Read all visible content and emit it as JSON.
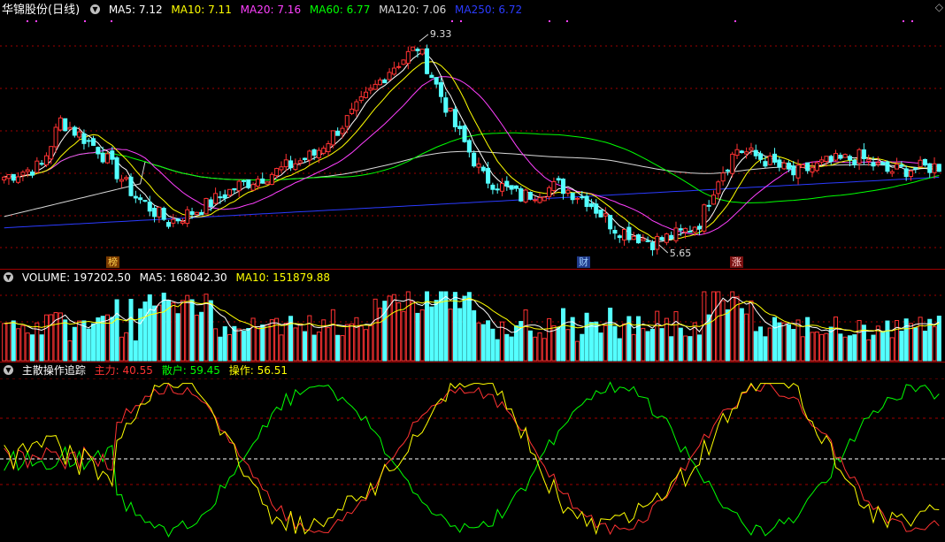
{
  "stock": {
    "title": "华锦股份(日线)"
  },
  "price_panel": {
    "ma": [
      {
        "label": "MA5: 7.12",
        "color": "#ffffff"
      },
      {
        "label": "MA10: 7.11",
        "color": "#ffff00"
      },
      {
        "label": "MA20: 7.16",
        "color": "#ff40ff"
      },
      {
        "label": "MA60: 6.77",
        "color": "#00ff00"
      },
      {
        "label": "MA120: 7.06",
        "color": "#d8d8d8"
      },
      {
        "label": "MA250: 6.72",
        "color": "#2b3bff"
      }
    ],
    "high_label": "9.33",
    "low_label": "5.65",
    "markers": [
      {
        "text": "榜",
        "bg": "#7a3a00",
        "color": "#ffd24d"
      },
      {
        "text": "财",
        "bg": "#1f3a8a",
        "color": "#9fd0ff"
      },
      {
        "text": "涨",
        "bg": "#7a1010",
        "color": "#ffd0d0"
      }
    ],
    "diamond_icon": "◇"
  },
  "volume_panel": {
    "label": "VOLUME: 197202.50",
    "ma5": "MA5: 168042.30",
    "ma10": "MA10: 151879.88"
  },
  "indicator_panel": {
    "name": "主散操作追踪",
    "zhuli": "主力: 40.55",
    "sanhu": "散户: 59.45",
    "caozuo": "操作: 56.51"
  },
  "colors": {
    "up": "#ff3232",
    "down": "#54ffff",
    "grid": "#a00000"
  }
}
